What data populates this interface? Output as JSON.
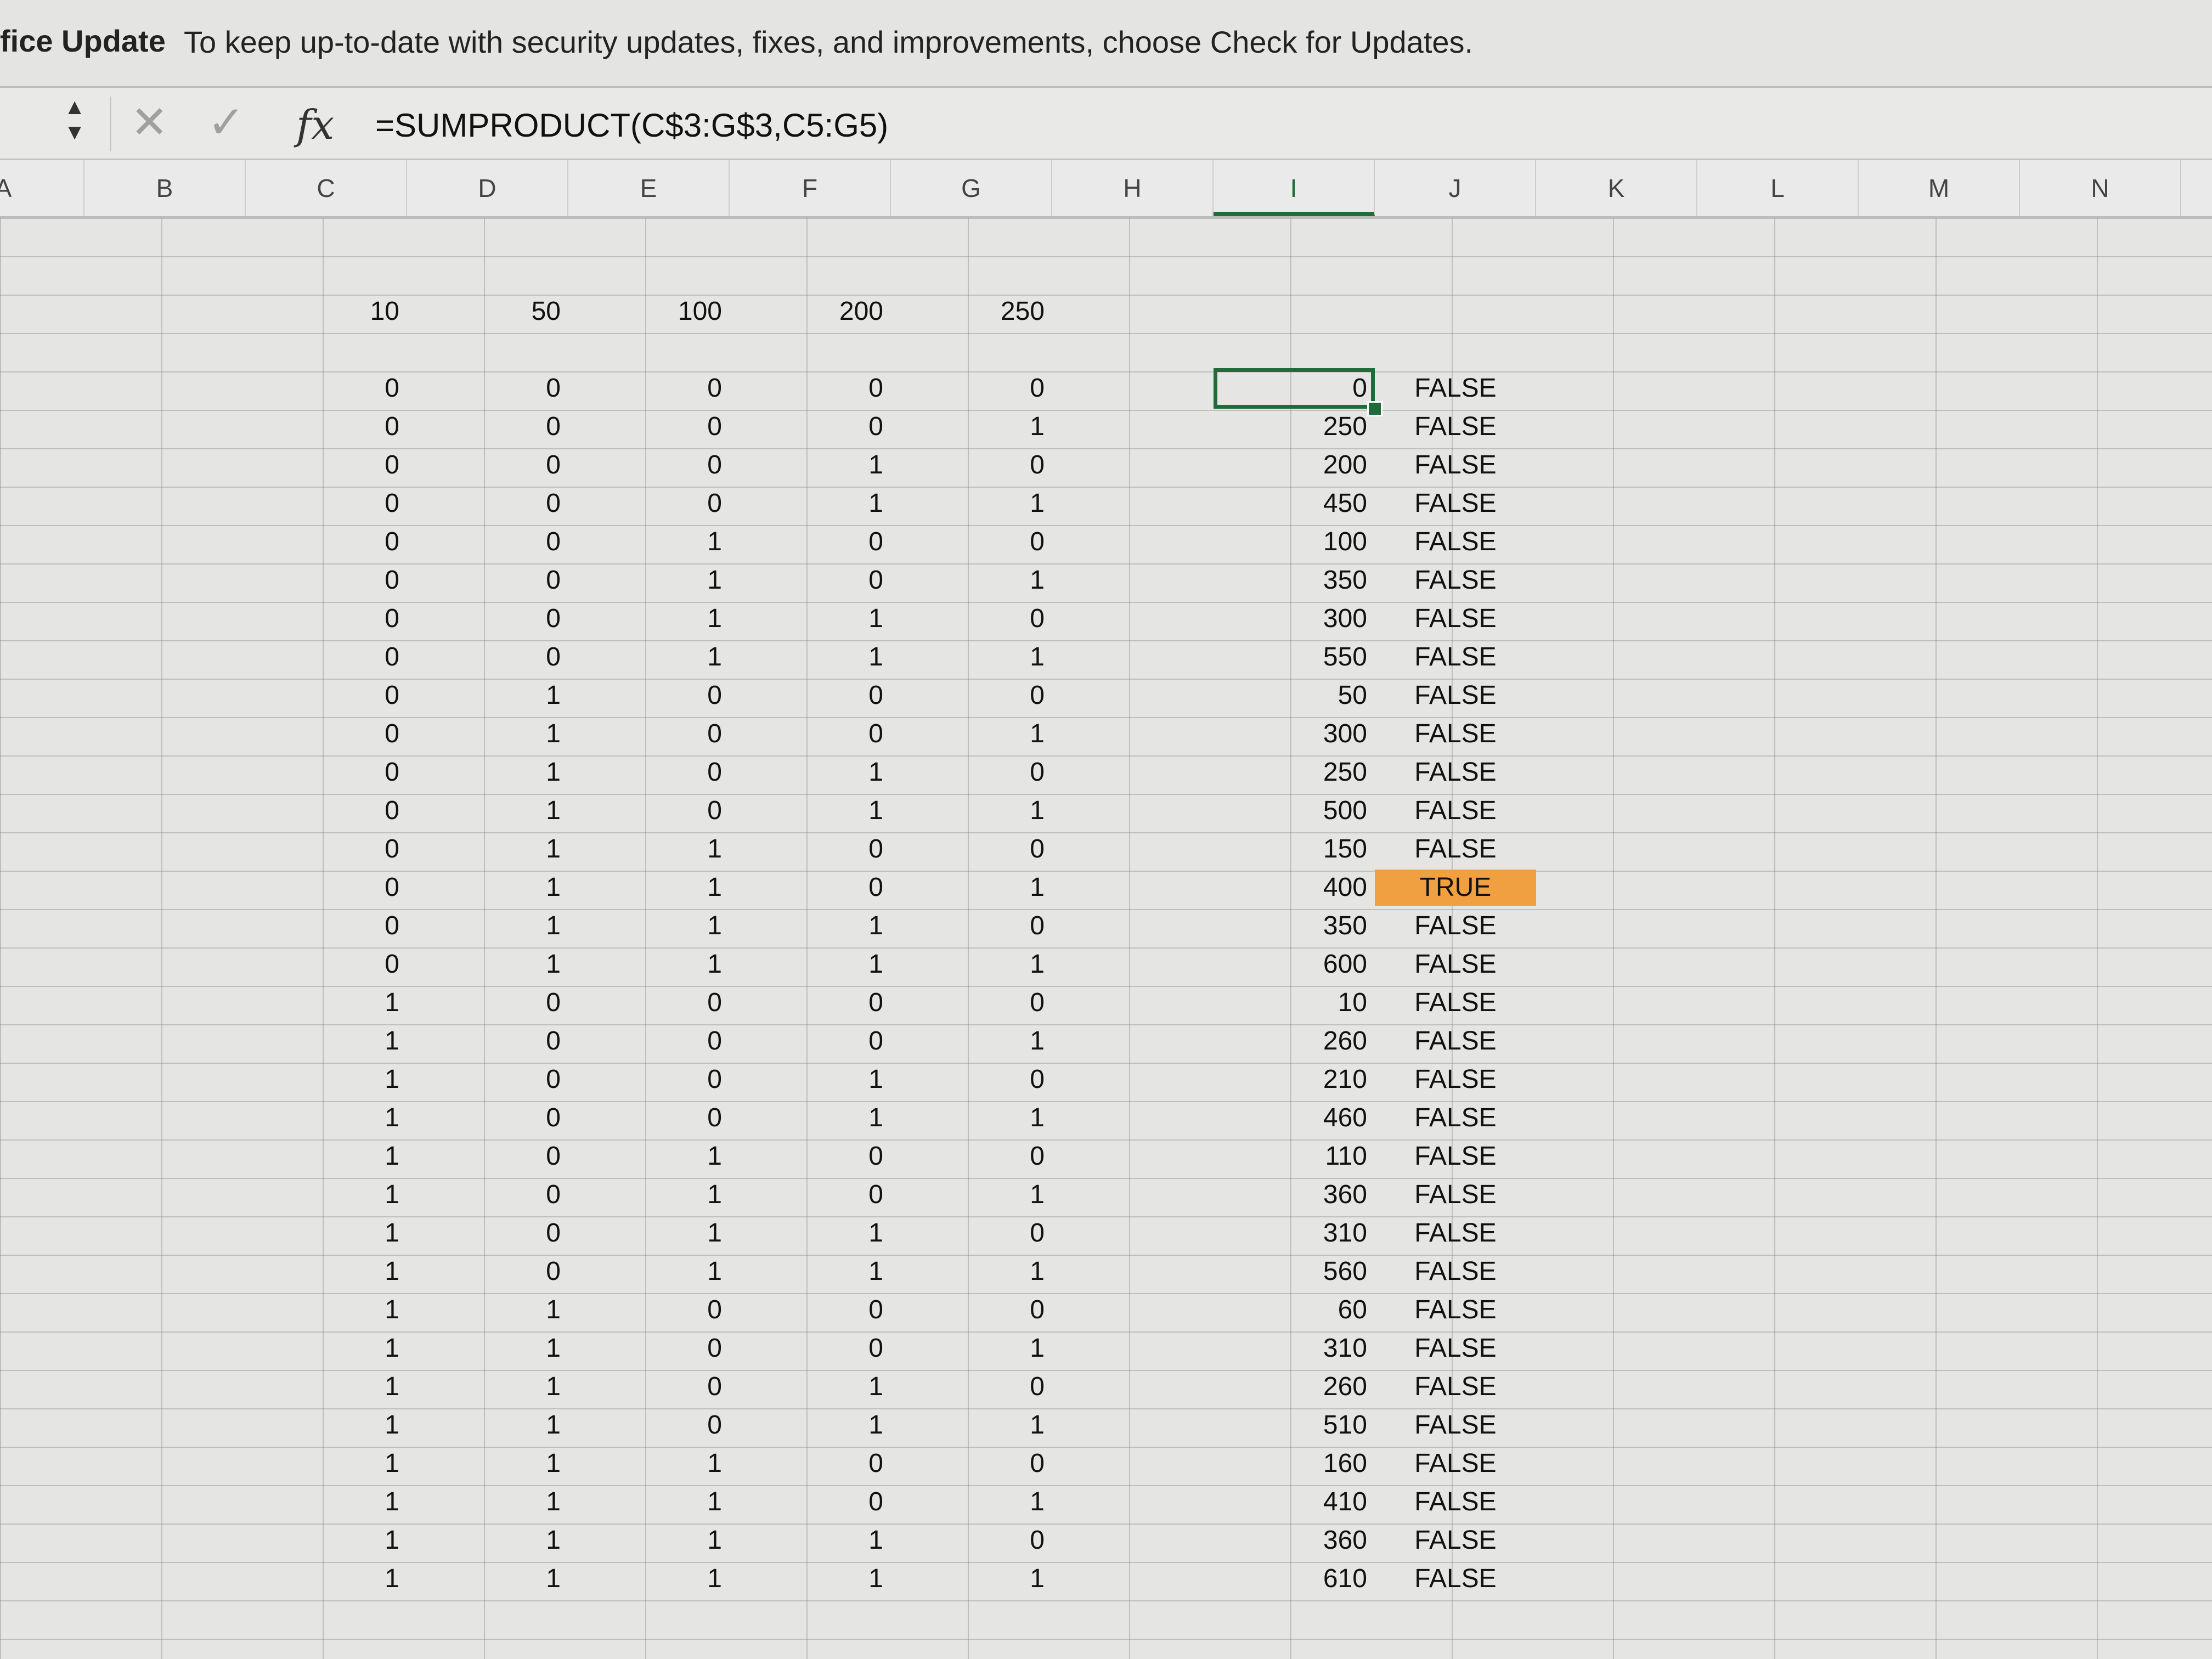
{
  "update_bar": {
    "title": "fice Update",
    "message": "To keep up-to-date with security updates, fixes, and improvements, choose Check for Updates."
  },
  "formula_bar": {
    "cancel_icon": "✕",
    "enter_icon": "✓",
    "fx_label": "fx",
    "formula": "=SUMPRODUCT(C$3:G$3,C5:G5)"
  },
  "columns": [
    "A",
    "B",
    "C",
    "D",
    "E",
    "F",
    "G",
    "H",
    "I",
    "J",
    "K",
    "L",
    "M",
    "N"
  ],
  "selected_column": "I",
  "weights": [
    "10",
    "50",
    "100",
    "200",
    "250"
  ],
  "rows": [
    {
      "bits": [
        "0",
        "0",
        "0",
        "0",
        "0"
      ],
      "sum": "0",
      "match": "FALSE"
    },
    {
      "bits": [
        "0",
        "0",
        "0",
        "0",
        "1"
      ],
      "sum": "250",
      "match": "FALSE"
    },
    {
      "bits": [
        "0",
        "0",
        "0",
        "1",
        "0"
      ],
      "sum": "200",
      "match": "FALSE"
    },
    {
      "bits": [
        "0",
        "0",
        "0",
        "1",
        "1"
      ],
      "sum": "450",
      "match": "FALSE"
    },
    {
      "bits": [
        "0",
        "0",
        "1",
        "0",
        "0"
      ],
      "sum": "100",
      "match": "FALSE"
    },
    {
      "bits": [
        "0",
        "0",
        "1",
        "0",
        "1"
      ],
      "sum": "350",
      "match": "FALSE"
    },
    {
      "bits": [
        "0",
        "0",
        "1",
        "1",
        "0"
      ],
      "sum": "300",
      "match": "FALSE"
    },
    {
      "bits": [
        "0",
        "0",
        "1",
        "1",
        "1"
      ],
      "sum": "550",
      "match": "FALSE"
    },
    {
      "bits": [
        "0",
        "1",
        "0",
        "0",
        "0"
      ],
      "sum": "50",
      "match": "FALSE"
    },
    {
      "bits": [
        "0",
        "1",
        "0",
        "0",
        "1"
      ],
      "sum": "300",
      "match": "FALSE"
    },
    {
      "bits": [
        "0",
        "1",
        "0",
        "1",
        "0"
      ],
      "sum": "250",
      "match": "FALSE"
    },
    {
      "bits": [
        "0",
        "1",
        "0",
        "1",
        "1"
      ],
      "sum": "500",
      "match": "FALSE"
    },
    {
      "bits": [
        "0",
        "1",
        "1",
        "0",
        "0"
      ],
      "sum": "150",
      "match": "FALSE"
    },
    {
      "bits": [
        "0",
        "1",
        "1",
        "0",
        "1"
      ],
      "sum": "400",
      "match": "TRUE"
    },
    {
      "bits": [
        "0",
        "1",
        "1",
        "1",
        "0"
      ],
      "sum": "350",
      "match": "FALSE"
    },
    {
      "bits": [
        "0",
        "1",
        "1",
        "1",
        "1"
      ],
      "sum": "600",
      "match": "FALSE"
    },
    {
      "bits": [
        "1",
        "0",
        "0",
        "0",
        "0"
      ],
      "sum": "10",
      "match": "FALSE"
    },
    {
      "bits": [
        "1",
        "0",
        "0",
        "0",
        "1"
      ],
      "sum": "260",
      "match": "FALSE"
    },
    {
      "bits": [
        "1",
        "0",
        "0",
        "1",
        "0"
      ],
      "sum": "210",
      "match": "FALSE"
    },
    {
      "bits": [
        "1",
        "0",
        "0",
        "1",
        "1"
      ],
      "sum": "460",
      "match": "FALSE"
    },
    {
      "bits": [
        "1",
        "0",
        "1",
        "0",
        "0"
      ],
      "sum": "110",
      "match": "FALSE"
    },
    {
      "bits": [
        "1",
        "0",
        "1",
        "0",
        "1"
      ],
      "sum": "360",
      "match": "FALSE"
    },
    {
      "bits": [
        "1",
        "0",
        "1",
        "1",
        "0"
      ],
      "sum": "310",
      "match": "FALSE"
    },
    {
      "bits": [
        "1",
        "0",
        "1",
        "1",
        "1"
      ],
      "sum": "560",
      "match": "FALSE"
    },
    {
      "bits": [
        "1",
        "1",
        "0",
        "0",
        "0"
      ],
      "sum": "60",
      "match": "FALSE"
    },
    {
      "bits": [
        "1",
        "1",
        "0",
        "0",
        "1"
      ],
      "sum": "310",
      "match": "FALSE"
    },
    {
      "bits": [
        "1",
        "1",
        "0",
        "1",
        "0"
      ],
      "sum": "260",
      "match": "FALSE"
    },
    {
      "bits": [
        "1",
        "1",
        "0",
        "1",
        "1"
      ],
      "sum": "510",
      "match": "FALSE"
    },
    {
      "bits": [
        "1",
        "1",
        "1",
        "0",
        "0"
      ],
      "sum": "160",
      "match": "FALSE"
    },
    {
      "bits": [
        "1",
        "1",
        "1",
        "0",
        "1"
      ],
      "sum": "410",
      "match": "FALSE"
    },
    {
      "bits": [
        "1",
        "1",
        "1",
        "1",
        "0"
      ],
      "sum": "360",
      "match": "FALSE"
    },
    {
      "bits": [
        "1",
        "1",
        "1",
        "1",
        "1"
      ],
      "sum": "610",
      "match": "FALSE"
    }
  ],
  "highlight_color": "#f0a040",
  "selection_color": "#1f6b3a"
}
